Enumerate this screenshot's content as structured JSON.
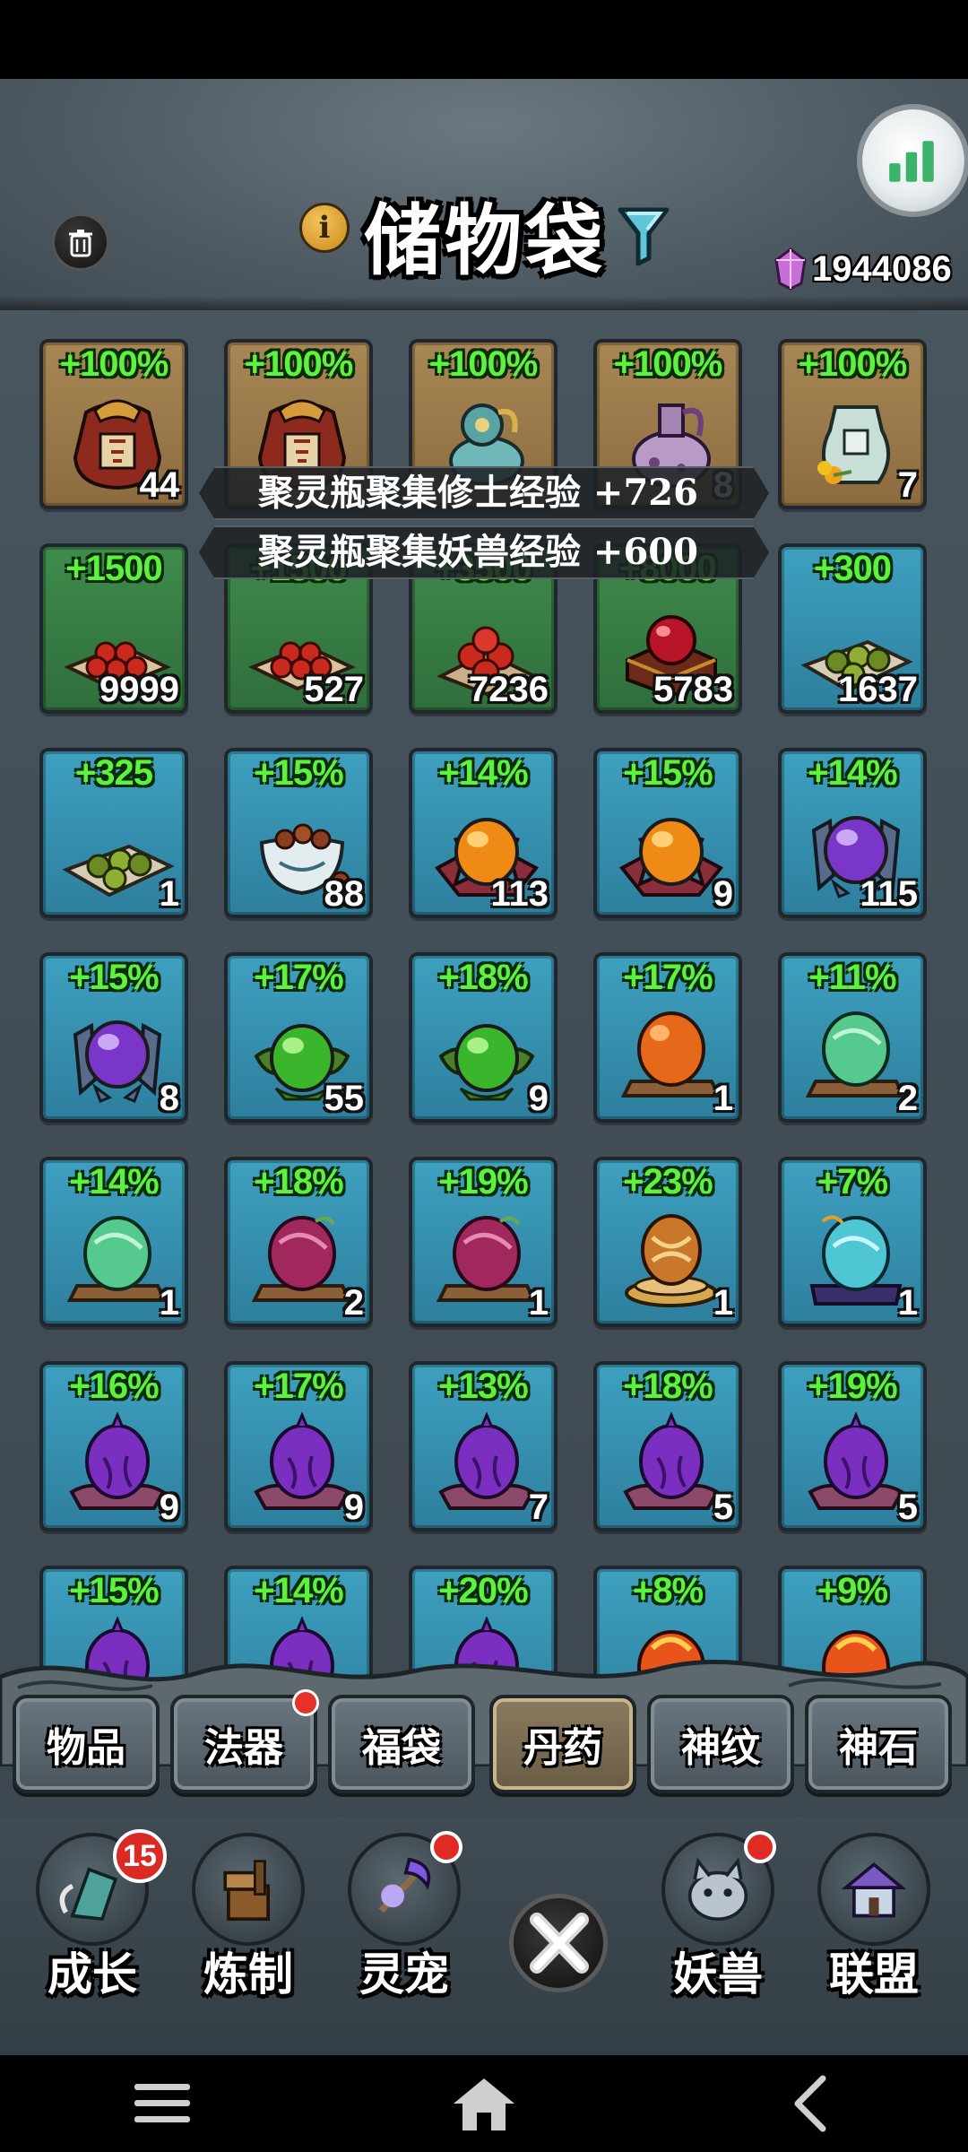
{
  "header": {
    "title": "储物袋",
    "currency_amount": "1944086",
    "info_icon": "info-icon",
    "trash_icon": "trash-icon",
    "filter_icon": "filter-icon",
    "stats_icon": "bar-chart-icon"
  },
  "toasts": [
    "聚灵瓶聚集修士经验 +726",
    "聚灵瓶聚集妖兽经验 +600"
  ],
  "items": [
    {
      "bonus": "+100%",
      "count": "44",
      "bg": "brown",
      "art": "wine-jar-red"
    },
    {
      "bonus": "+100%",
      "count": "",
      "bg": "brown",
      "art": "wine-jar-red"
    },
    {
      "bonus": "+100%",
      "count": "",
      "bg": "brown",
      "art": "spirit-gourd"
    },
    {
      "bonus": "+100%",
      "count": "8",
      "bg": "brown",
      "art": "purple-vase"
    },
    {
      "bonus": "+100%",
      "count": "7",
      "bg": "brown",
      "art": "flower-vase"
    },
    {
      "bonus": "+1500",
      "count": "9999",
      "bg": "green",
      "art": "red-pills"
    },
    {
      "bonus": "+1500",
      "count": "527",
      "bg": "green",
      "art": "red-pills"
    },
    {
      "bonus": "+3500",
      "count": "7236",
      "bg": "green",
      "art": "red-pills-tray"
    },
    {
      "bonus": "+8000",
      "count": "5783",
      "bg": "green",
      "art": "red-pearl-box"
    },
    {
      "bonus": "+300",
      "count": "1637",
      "bg": "blue",
      "art": "green-pills"
    },
    {
      "bonus": "+325",
      "count": "1",
      "bg": "blue",
      "art": "green-pills"
    },
    {
      "bonus": "+15%",
      "count": "88",
      "bg": "blue",
      "art": "pill-bowl"
    },
    {
      "bonus": "+14%",
      "count": "113",
      "bg": "blue",
      "art": "orange-lotus"
    },
    {
      "bonus": "+15%",
      "count": "9",
      "bg": "blue",
      "art": "orange-lotus"
    },
    {
      "bonus": "+14%",
      "count": "115",
      "bg": "blue",
      "art": "purple-orb"
    },
    {
      "bonus": "+15%",
      "count": "8",
      "bg": "blue",
      "art": "purple-orb"
    },
    {
      "bonus": "+17%",
      "count": "55",
      "bg": "blue",
      "art": "green-leaf-orb"
    },
    {
      "bonus": "+18%",
      "count": "9",
      "bg": "blue",
      "art": "green-leaf-orb"
    },
    {
      "bonus": "+17%",
      "count": "1",
      "bg": "blue",
      "art": "orange-egg"
    },
    {
      "bonus": "+11%",
      "count": "2",
      "bg": "blue",
      "art": "jade-egg"
    },
    {
      "bonus": "+14%",
      "count": "1",
      "bg": "blue",
      "art": "jade-egg"
    },
    {
      "bonus": "+18%",
      "count": "2",
      "bg": "blue",
      "art": "magenta-egg"
    },
    {
      "bonus": "+19%",
      "count": "1",
      "bg": "blue",
      "art": "magenta-egg"
    },
    {
      "bonus": "+23%",
      "count": "1",
      "bg": "blue",
      "art": "golden-egg"
    },
    {
      "bonus": "+7%",
      "count": "1",
      "bg": "blue",
      "art": "cyan-egg"
    },
    {
      "bonus": "+16%",
      "count": "9",
      "bg": "blue",
      "art": "violet-bud"
    },
    {
      "bonus": "+17%",
      "count": "9",
      "bg": "blue",
      "art": "violet-bud"
    },
    {
      "bonus": "+13%",
      "count": "7",
      "bg": "blue",
      "art": "violet-bud"
    },
    {
      "bonus": "+18%",
      "count": "5",
      "bg": "blue",
      "art": "violet-bud"
    },
    {
      "bonus": "+19%",
      "count": "5",
      "bg": "blue",
      "art": "violet-bud"
    },
    {
      "bonus": "+15%",
      "count": "",
      "bg": "blue",
      "art": "violet-bud"
    },
    {
      "bonus": "+14%",
      "count": "",
      "bg": "blue",
      "art": "violet-bud"
    },
    {
      "bonus": "+20%",
      "count": "",
      "bg": "blue",
      "art": "violet-bud"
    },
    {
      "bonus": "+8%",
      "count": "",
      "bg": "blue",
      "art": "fire-egg"
    },
    {
      "bonus": "+9%",
      "count": "",
      "bg": "blue",
      "art": "fire-egg"
    }
  ],
  "tabs": [
    {
      "label": "物品",
      "active": false,
      "dot": false
    },
    {
      "label": "法器",
      "active": false,
      "dot": true
    },
    {
      "label": "福袋",
      "active": false,
      "dot": false
    },
    {
      "label": "丹药",
      "active": true,
      "dot": false
    },
    {
      "label": "神纹",
      "active": false,
      "dot": false
    },
    {
      "label": "神石",
      "active": false,
      "dot": false
    }
  ],
  "nav": [
    {
      "label": "成长",
      "badge": "15",
      "dot": false,
      "icon": "growth-icon"
    },
    {
      "label": "炼制",
      "badge": "",
      "dot": false,
      "icon": "forge-icon"
    },
    {
      "label": "灵宠",
      "badge": "",
      "dot": true,
      "icon": "spirit-pet-icon"
    },
    {
      "label": "妖兽",
      "badge": "",
      "dot": true,
      "icon": "demon-beast-icon"
    },
    {
      "label": "联盟",
      "badge": "",
      "dot": false,
      "icon": "alliance-icon"
    }
  ],
  "colors": {
    "bonus_text": "#5cf23e",
    "tab_active": "#8a7b60",
    "badge_red": "#d92a24"
  }
}
